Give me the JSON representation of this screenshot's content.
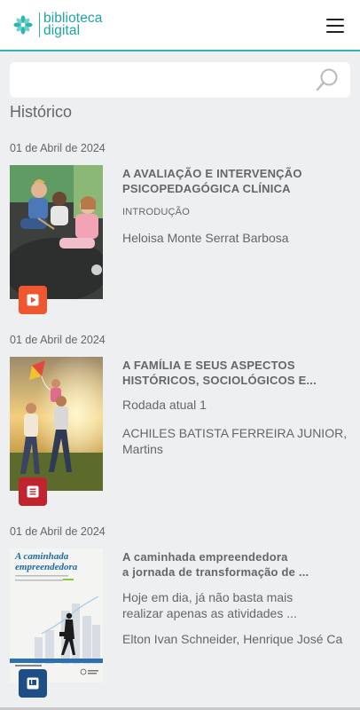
{
  "header": {
    "logo_line1": "biblioteca",
    "logo_line2": "digital",
    "brand_color": "#2fb5b1"
  },
  "search": {
    "placeholder": "",
    "value": ""
  },
  "page": {
    "section_title": "Histórico"
  },
  "items": [
    {
      "date": "01 de Abril de 2024",
      "title_line1": "A AVALIAÇÃO E INTERVENÇÃO",
      "title_line2": "PSICOPEDAGÓGICA CLÍNICA",
      "subtitle": "INTRODUÇÃO",
      "author": "Heloisa Monte Serrat Barbosa",
      "badge_icon": "play-icon",
      "badge_color": "#f0572e"
    },
    {
      "date": "01 de Abril de 2024",
      "title_line1": "A FAMÍLIA E SEUS ASPECTOS",
      "title_line2": "HISTÓRICOS, SOCIOLÓGICOS E...",
      "line1": "Rodada atual 1",
      "author_line1": "ACHILES BATISTA FERREIRA JUNIOR,",
      "author_line2": "Martins",
      "badge_icon": "article-icon",
      "badge_color": "#c0242f"
    },
    {
      "date": "01 de Abril de 2024",
      "title_line1": "A caminhada empreendedora",
      "title_line2": "a jornada de transformação de ...",
      "desc_line1": "Hoje em dia, já não basta mais",
      "desc_line2": "realizar apenas as atividades ...",
      "author": "Elton Ivan Schneider, Henrique José Ca",
      "cover_title_line1": "A caminhada",
      "cover_title_line2": "empreendedora",
      "badge_icon": "book-icon",
      "badge_color": "#1d4f86"
    }
  ]
}
